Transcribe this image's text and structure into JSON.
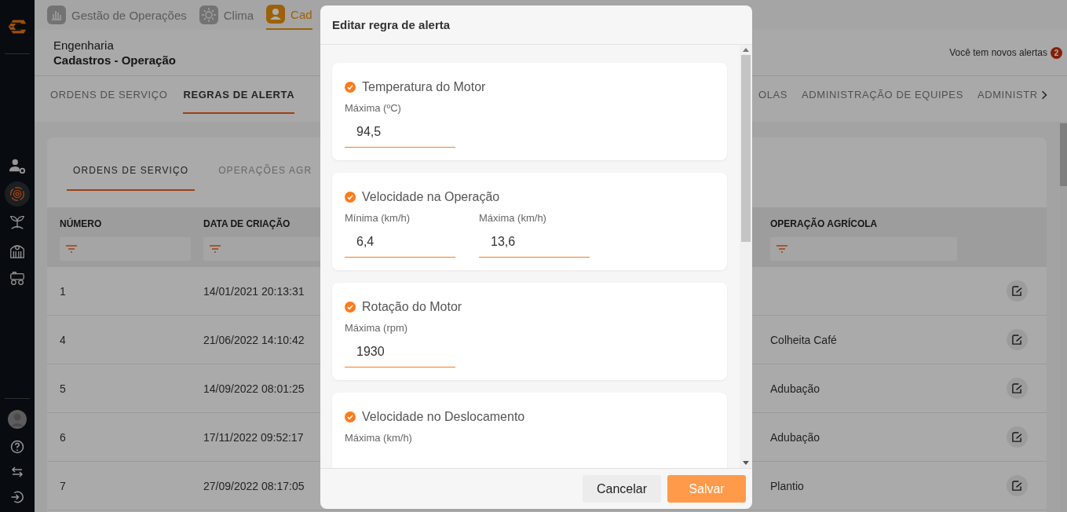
{
  "sidebar": {
    "items": [
      {
        "selected": false
      },
      {
        "selected": true
      },
      {
        "selected": false
      },
      {
        "selected": false
      },
      {
        "selected": false
      }
    ]
  },
  "app_tabs": [
    {
      "label": "Gestão de Operações",
      "selected": false
    },
    {
      "label": "Clima",
      "selected": false
    },
    {
      "label": "Cad",
      "selected": true
    }
  ],
  "header": {
    "section": "Engenharia",
    "title": "Cadastros - Operação",
    "alerts_text": "Você tem novos alertas",
    "alerts_count": "2"
  },
  "nav_tabs_left": [
    {
      "label": "ORDENS DE SERVIÇO",
      "selected": false
    },
    {
      "label": "REGRAS DE ALERTA",
      "selected": true
    }
  ],
  "nav_tabs_right": [
    {
      "label": "OLAS",
      "selected": false
    },
    {
      "label": "ADMINISTRAÇÃO DE EQUIPES",
      "selected": false
    },
    {
      "label": "ADMINISTR",
      "selected": false
    }
  ],
  "inner_tabs": [
    {
      "label": "ORDENS DE SERVIÇO",
      "selected": true
    },
    {
      "label": "OPERAÇÕES AGR",
      "selected": false
    }
  ],
  "table": {
    "columns": [
      "NÚMERO",
      "DATA DE CRIAÇÃO",
      "OPERAÇÃO AGRÍCOLA"
    ],
    "rows": [
      [
        "1",
        "14/01/2021 20:13:31",
        ""
      ],
      [
        "4",
        "21/06/2022 14:10:42",
        "Colheita Café"
      ],
      [
        "5",
        "14/09/2022 08:01:25",
        "Adubação"
      ],
      [
        "6",
        "17/11/2022 09:52:17",
        "Adubação"
      ],
      [
        "7",
        "27/09/2022 08:17:05",
        "Plantio"
      ]
    ]
  },
  "dialog": {
    "title": "Editar regra de alerta",
    "rules": [
      {
        "title": "Temperatura do Motor",
        "checked": true,
        "fields": [
          {
            "label": "Máxima (ºC)",
            "value": "94,5"
          }
        ]
      },
      {
        "title": "Velocidade na Operação",
        "checked": true,
        "fields": [
          {
            "label": "Mínima (km/h)",
            "value": "6,4"
          },
          {
            "label": "Máxima (km/h)",
            "value": "13,6"
          }
        ]
      },
      {
        "title": "Rotação do Motor",
        "checked": true,
        "fields": [
          {
            "label": "Máxima (rpm)",
            "value": "1930"
          }
        ]
      },
      {
        "title": "Velocidade no Deslocamento",
        "checked": true,
        "fields": [
          {
            "label": "Máxima (km/h)"
          }
        ]
      }
    ],
    "cancel": "Cancelar",
    "save": "Salvar"
  }
}
